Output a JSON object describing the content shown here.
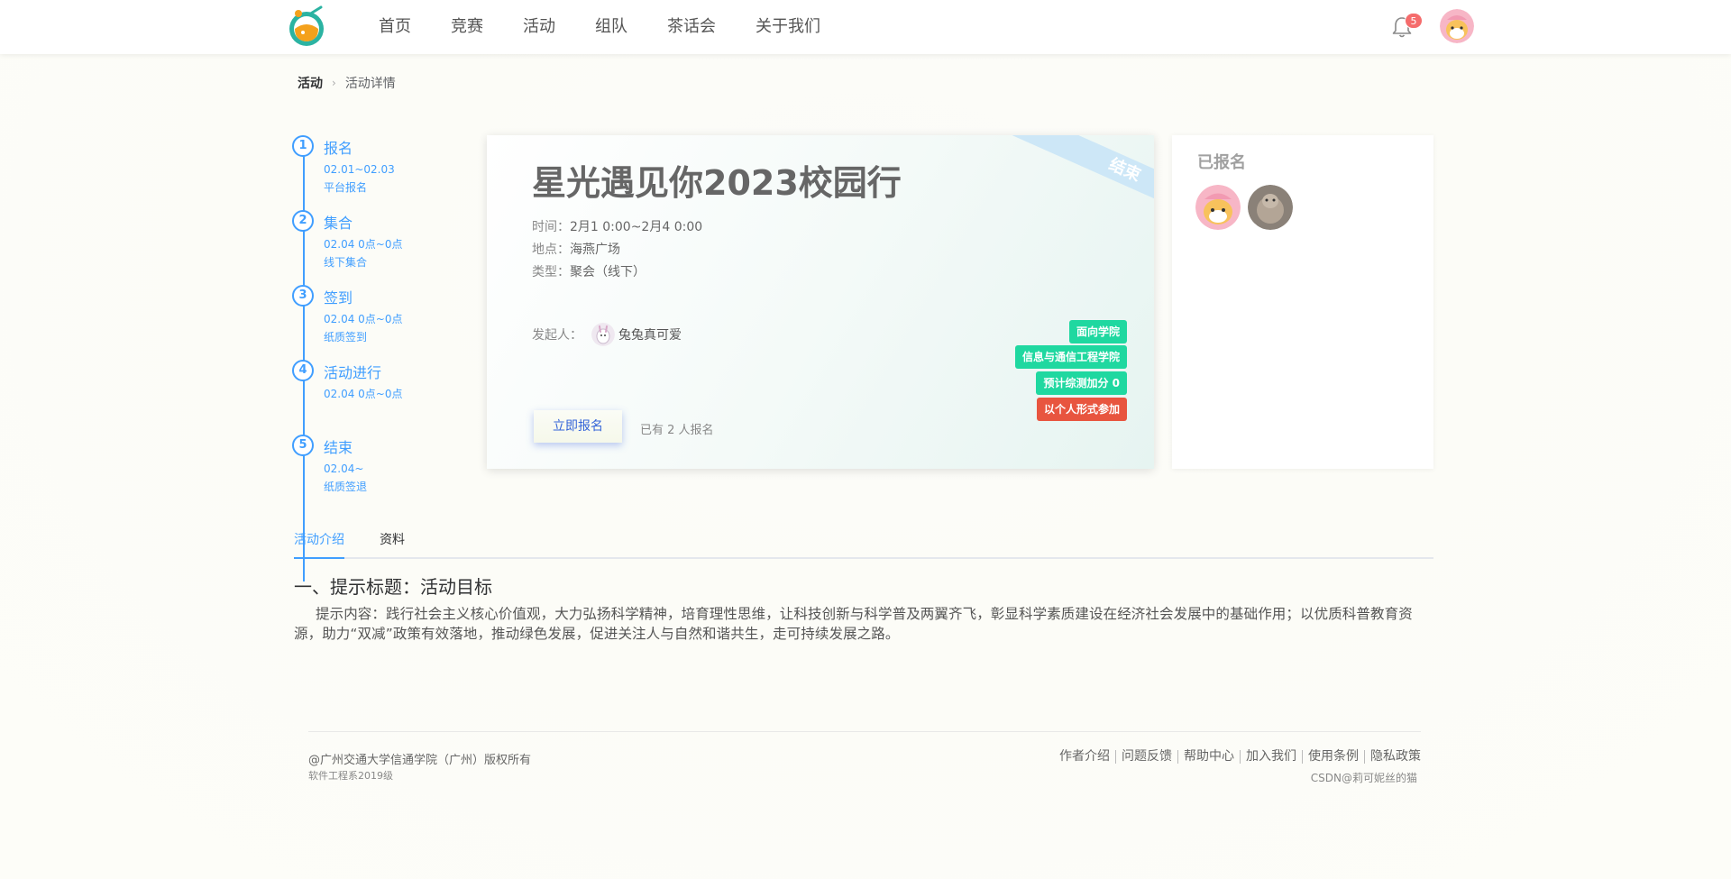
{
  "nav": {
    "items": [
      "首页",
      "竞赛",
      "活动",
      "组队",
      "茶话会",
      "关于我们"
    ],
    "notification_count": "5"
  },
  "breadcrumb": {
    "root": "活动",
    "current": "活动详情"
  },
  "steps": [
    {
      "num": "1",
      "title": "报名",
      "desc": [
        "02.01~02.03",
        "平台报名"
      ]
    },
    {
      "num": "2",
      "title": "集合",
      "desc": [
        "02.04 0点~0点",
        "线下集合"
      ]
    },
    {
      "num": "3",
      "title": "签到",
      "desc": [
        "02.04 0点~0点",
        "纸质签到"
      ]
    },
    {
      "num": "4",
      "title": "活动进行",
      "desc": [
        "02.04 0点~0点",
        ""
      ]
    },
    {
      "num": "5",
      "title": "结束",
      "desc": [
        "02.04~",
        "纸质签退"
      ]
    }
  ],
  "event": {
    "ribbon": "结束",
    "title": "星光遇见你2023校园行",
    "time_label": "时间：",
    "time": "2月1 0:00~2月4 0:00",
    "location_label": "地点：",
    "location": "海燕广场",
    "type_label": "类型：",
    "type": "聚会（线下）",
    "organizer_label": "发起人：",
    "organizer": "兔兔真可爱",
    "tags": [
      "面向学院",
      "信息与通信工程学院",
      "预计综测加分 0",
      "以个人形式参加"
    ],
    "signup_button": "立即报名",
    "signup_count": "已有 2 人报名"
  },
  "registered": {
    "title": "已报名"
  },
  "tabs": [
    "活动介绍",
    "资料"
  ],
  "content": {
    "title": "一、提示标题：活动目标",
    "body": "提示内容：践行社会主义核心价值观，大力弘扬科学精神，培育理性思维，让科技创新与科学普及两翼齐飞，彰显科学素质建设在经济社会发展中的基础作用；以优质科普教育资源，助力“双减”政策有效落地，推动绿色发展，促进关注人与自然和谐共生，走可持续发展之路。"
  },
  "footer": {
    "copyright": "@广州交通大学信通学院（广州）版权所有",
    "class_line": "软件工程系2019级",
    "links": [
      "作者介绍",
      "问题反馈",
      "帮助中心",
      "加入我们",
      "使用条例",
      "隐私政策"
    ],
    "credit": "CSDN@莉可妮丝的猫"
  },
  "colors": {
    "accent": "#409eff",
    "tag_green": "#1fd8a0",
    "tag_red": "#e8553f",
    "badge": "#f56c6c",
    "ribbon": "#cde7f7"
  },
  "icons": [
    "logo-icon",
    "bell-icon",
    "user-avatar",
    "organizer-avatar",
    "chevron-right-icon"
  ]
}
